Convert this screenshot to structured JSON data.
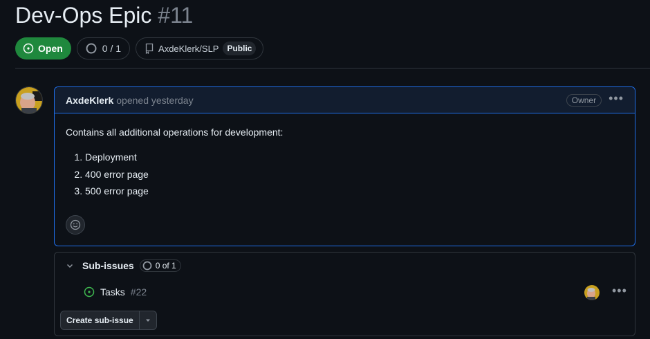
{
  "issue": {
    "title": "Dev-Ops Epic",
    "number": "#11",
    "state": "Open",
    "progress_text": "0 / 1",
    "repo": "AxdeKlerk/SLP",
    "visibility": "Public"
  },
  "comment": {
    "author": "AxdeKlerk",
    "opened_text": "opened yesterday",
    "role_badge": "Owner",
    "intro": "Contains all additional operations for development:",
    "items": [
      "Deployment",
      "400 error page",
      "500 error page"
    ]
  },
  "sub_issues": {
    "title": "Sub-issues",
    "count": "0 of 1",
    "items": [
      {
        "title": "Tasks",
        "number": "#22"
      }
    ],
    "create_label": "Create sub-issue"
  },
  "colors": {
    "open_green": "#1f883d",
    "accent_blue": "#1f6feb",
    "bg": "#0d1117"
  }
}
